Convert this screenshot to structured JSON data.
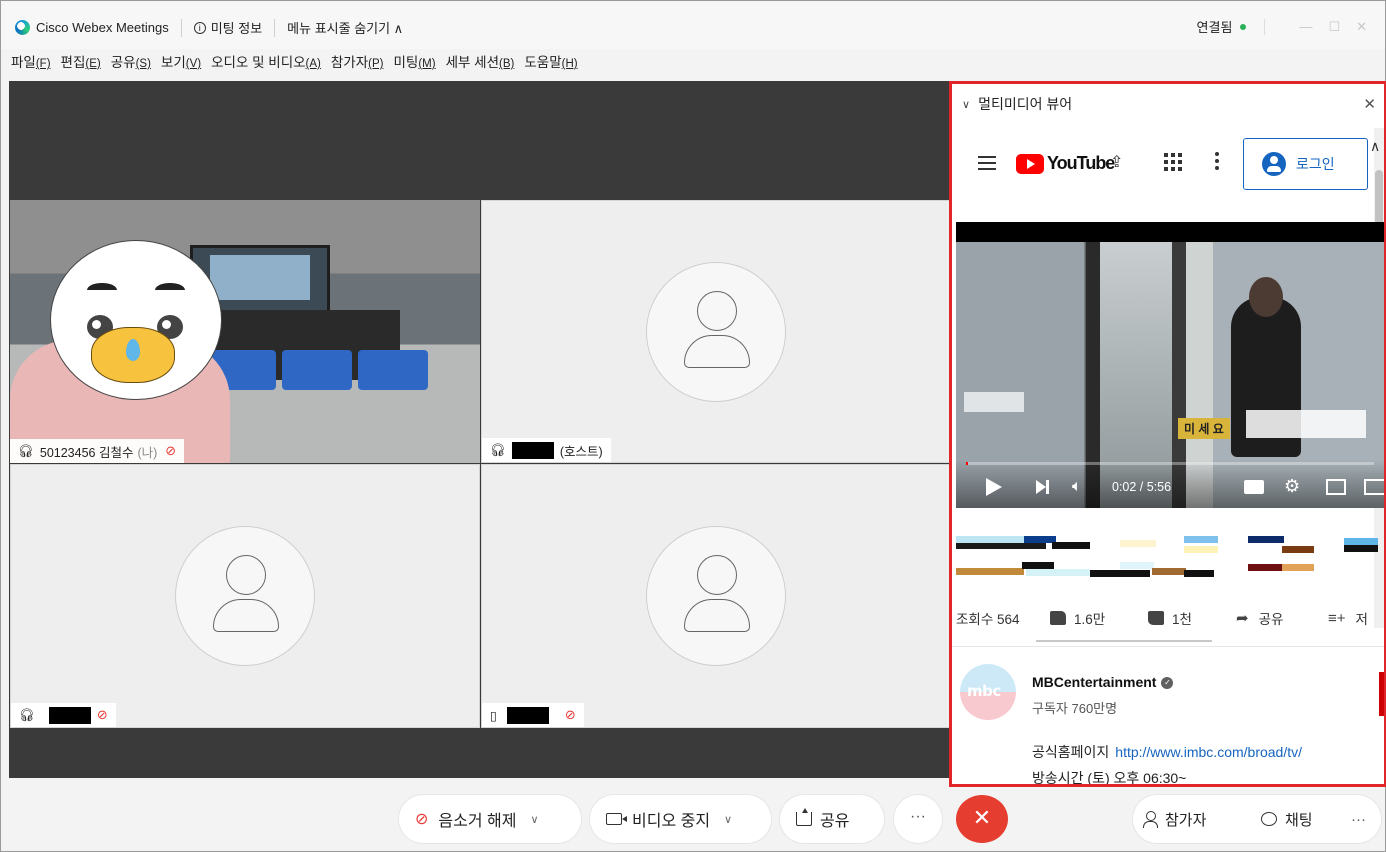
{
  "titlebar": {
    "app_name": "Cisco Webex Meetings",
    "meeting_info": "미팅 정보",
    "hide_menu": "메뉴 표시줄 숨기기 ∧",
    "status": "연결됨",
    "status_color": "#2ab05a",
    "minimize": "—",
    "maximize": "☐",
    "close": "✕"
  },
  "menu": {
    "items": [
      {
        "label": "파일",
        "key": "(F)"
      },
      {
        "label": "편집",
        "key": "(E)"
      },
      {
        "label": "공유",
        "key": "(S)"
      },
      {
        "label": "보기",
        "key": "(V)"
      },
      {
        "label": "오디오 및 비디오",
        "key": "(A)"
      },
      {
        "label": "참가자",
        "key": "(P)"
      },
      {
        "label": "미팅",
        "key": "(M)"
      },
      {
        "label": "세부 세션",
        "key": "(B)"
      },
      {
        "label": "도움말",
        "key": "(H)"
      }
    ]
  },
  "participants": {
    "self": {
      "id": "50123456 김철수",
      "me": "(나)"
    },
    "host": {
      "role": "(호스트)"
    }
  },
  "viewer": {
    "title": "멀티미디어 뷰어",
    "login": "로그인",
    "yt_text": "YouTube",
    "sign_text": "미 세 요",
    "time": "0:02 / 5:56",
    "progress": 0.006,
    "views": "조회수 564",
    "likes": "1.6만",
    "dislikes": "1천",
    "share": "공유",
    "save": "저",
    "channel": "MBCentertainment",
    "channel_logo": "mbc",
    "subscribers": "구독자 760만명",
    "homepage_label": "공식홈페이지",
    "homepage_url": "http://www.imbc.com/broad/tv/",
    "broadcast": "방송시간 (토) 오후 06:30~",
    "accent": "#e0262a"
  },
  "toolbar": {
    "unmute": "음소거 해제",
    "stop_video": "비디오 중지",
    "share": "공유",
    "more": "···",
    "leave": "✕",
    "participants": "참가자",
    "chat": "채팅",
    "more_right": "···"
  }
}
